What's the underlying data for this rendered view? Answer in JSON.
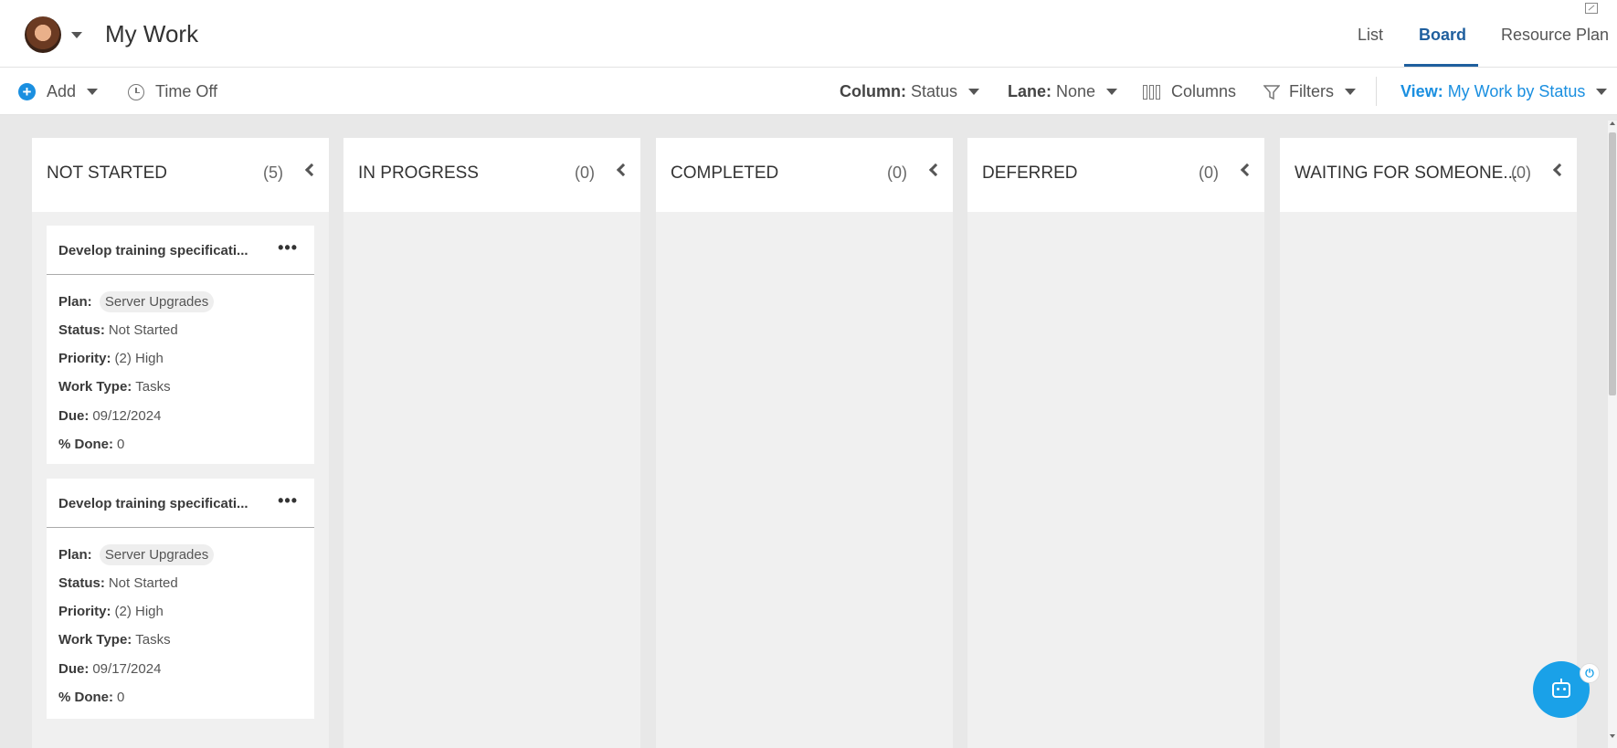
{
  "header": {
    "title": "My Work",
    "tabs": [
      {
        "label": "List"
      },
      {
        "label": "Board"
      },
      {
        "label": "Resource Plan"
      }
    ]
  },
  "toolbar": {
    "add_label": "Add",
    "time_off_label": "Time Off",
    "column_key": "Column:",
    "column_value": "Status",
    "lane_key": "Lane:",
    "lane_value": "None",
    "columns_label": "Columns",
    "filters_label": "Filters",
    "view_key": "View:",
    "view_value": "My Work by Status"
  },
  "columns": [
    {
      "title": "NOT STARTED",
      "count": "(5)"
    },
    {
      "title": "IN PROGRESS",
      "count": "(0)"
    },
    {
      "title": "COMPLETED",
      "count": "(0)"
    },
    {
      "title": "DEFERRED",
      "count": "(0)"
    },
    {
      "title": "WAITING FOR SOMEONE...",
      "count": "(0)"
    }
  ],
  "card_labels": {
    "plan": "Plan:",
    "status": "Status:",
    "priority": "Priority:",
    "work_type": "Work Type:",
    "due": "Due:",
    "done": "% Done:",
    "more": "•••"
  },
  "cards": [
    {
      "title": "Develop training specificati...",
      "plan": "Server Upgrades",
      "status": "Not Started",
      "priority": "(2) High",
      "work_type": "Tasks",
      "due": "09/12/2024",
      "done": "0"
    },
    {
      "title": "Develop training specificati...",
      "plan": "Server Upgrades",
      "status": "Not Started",
      "priority": "(2) High",
      "work_type": "Tasks",
      "due": "09/17/2024",
      "done": "0"
    }
  ],
  "colors": {
    "accent": "#1a8fe0",
    "tab_active": "#1f5f9e",
    "board_bg": "#e8e8e8",
    "fab": "#1aa1e8"
  }
}
